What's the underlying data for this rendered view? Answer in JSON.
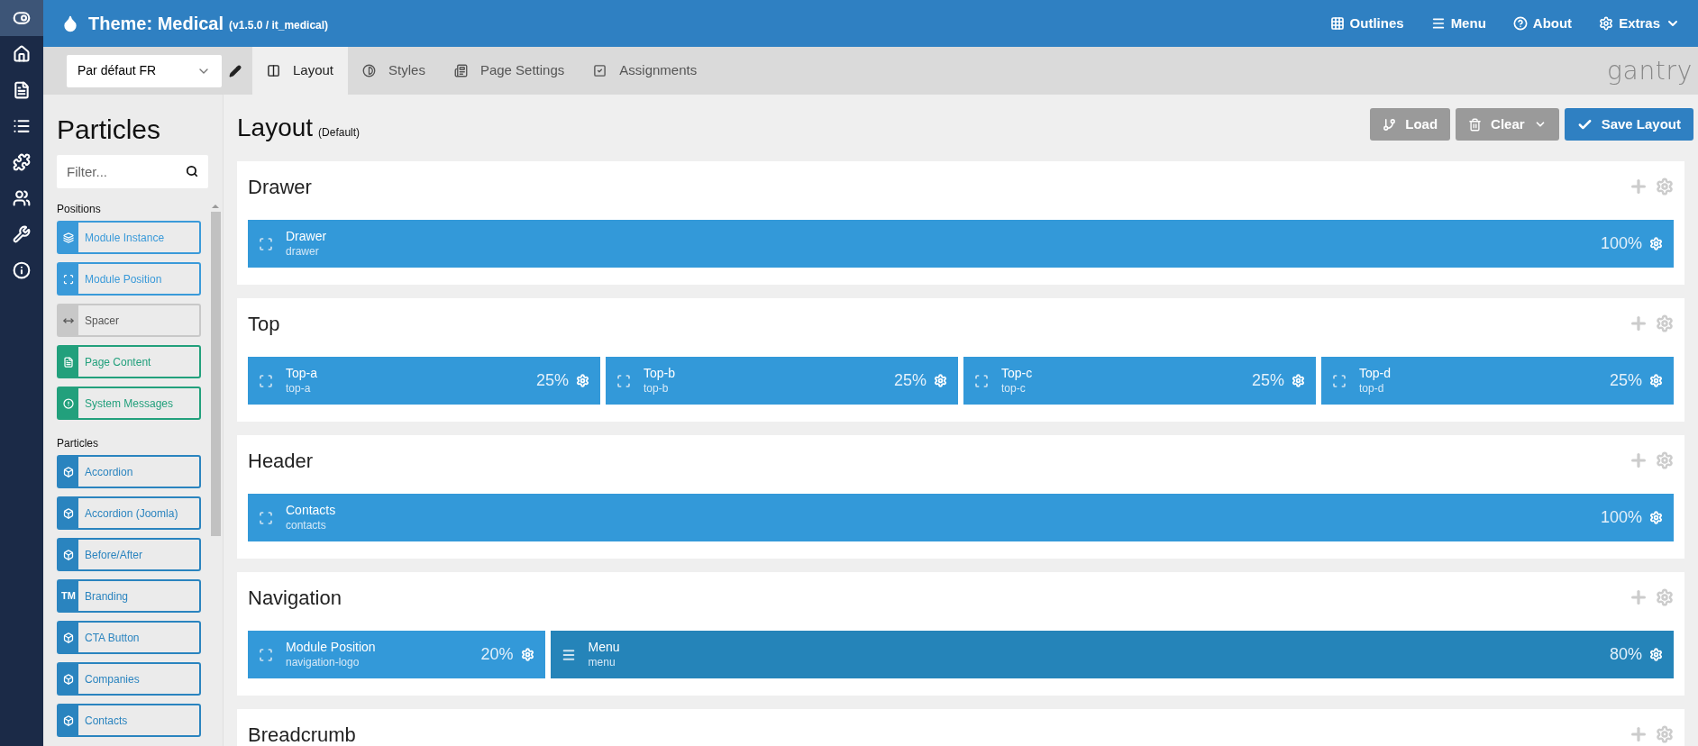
{
  "topbar": {
    "title": "Theme: Medical",
    "version": "(v1.5.0 / it_medical)",
    "menu": [
      {
        "kind": "outlines",
        "label": "Outlines"
      },
      {
        "kind": "menu",
        "label": "Menu"
      },
      {
        "kind": "about",
        "label": "About"
      },
      {
        "kind": "extras",
        "label": "Extras"
      }
    ]
  },
  "rail": [
    {
      "kind": "toggle",
      "selected": true
    },
    {
      "kind": "home",
      "selected": false
    },
    {
      "kind": "page",
      "selected": false
    },
    {
      "kind": "list",
      "selected": false
    },
    {
      "kind": "puzzle",
      "selected": false
    },
    {
      "kind": "users",
      "selected": false
    },
    {
      "kind": "wrench",
      "selected": false
    },
    {
      "kind": "info",
      "selected": false
    }
  ],
  "outline_select": {
    "value": "Par défaut FR"
  },
  "tabs": [
    {
      "kind": "layout",
      "label": "Layout",
      "selected": true
    },
    {
      "kind": "styles",
      "label": "Styles",
      "selected": false
    },
    {
      "kind": "settings",
      "label": "Page Settings",
      "selected": false
    },
    {
      "kind": "assignments",
      "label": "Assignments",
      "selected": false
    }
  ],
  "logo": "gantry",
  "particles": {
    "title": "Particles",
    "filter": {
      "placeholder": "Filter..."
    },
    "groups": [
      {
        "label": "Positions",
        "items": [
          {
            "kind": "instance",
            "label": "Module Instance",
            "color": "#3a9ad9"
          },
          {
            "kind": "position",
            "label": "Module Position",
            "color": "#3a9ad9"
          },
          {
            "kind": "spacer",
            "label": "Spacer",
            "color": "#c8c8c8"
          },
          {
            "kind": "page",
            "label": "Page Content",
            "color": "#22a07c"
          },
          {
            "kind": "messages",
            "label": "System Messages",
            "color": "#22a07c"
          }
        ]
      },
      {
        "label": "Particles",
        "items": [
          {
            "kind": "particle",
            "label": "Accordion",
            "color": "#2a84bf"
          },
          {
            "kind": "particle",
            "label": "Accordion (Joomla)",
            "color": "#2a84bf"
          },
          {
            "kind": "particle",
            "label": "Before/After",
            "color": "#2a84bf"
          },
          {
            "kind": "branding",
            "label": "Branding",
            "icon_text": "TM",
            "color": "#2a84bf"
          },
          {
            "kind": "particle",
            "label": "CTA Button",
            "color": "#2a84bf"
          },
          {
            "kind": "particle",
            "label": "Companies",
            "color": "#2a84bf"
          },
          {
            "kind": "particle",
            "label": "Contacts",
            "color": "#2a84bf"
          }
        ]
      }
    ]
  },
  "layout": {
    "title": "Layout",
    "subtitle": "(Default)",
    "buttons": [
      {
        "kind": "load",
        "label": "Load"
      },
      {
        "kind": "clear",
        "label": "Clear"
      },
      {
        "kind": "save",
        "label": "Save Layout"
      }
    ],
    "sections": [
      {
        "title": "Drawer",
        "blocks": [
          {
            "kind": "position",
            "name": "Drawer",
            "key": "drawer",
            "size": "100%"
          }
        ]
      },
      {
        "title": "Top",
        "blocks": [
          {
            "kind": "position",
            "name": "Top-a",
            "key": "top-a",
            "size": "25%"
          },
          {
            "kind": "position",
            "name": "Top-b",
            "key": "top-b",
            "size": "25%"
          },
          {
            "kind": "position",
            "name": "Top-c",
            "key": "top-c",
            "size": "25%"
          },
          {
            "kind": "position",
            "name": "Top-d",
            "key": "top-d",
            "size": "25%"
          }
        ]
      },
      {
        "title": "Header",
        "blocks": [
          {
            "kind": "position",
            "name": "Contacts",
            "key": "contacts",
            "size": "100%"
          }
        ]
      },
      {
        "title": "Navigation",
        "blocks": [
          {
            "kind": "position",
            "name": "Module Position",
            "key": "navigation-logo",
            "size": "20%"
          },
          {
            "kind": "menu",
            "name": "Menu",
            "key": "menu",
            "size": "80%"
          }
        ]
      },
      {
        "title": "Breadcrumb"
      }
    ]
  }
}
